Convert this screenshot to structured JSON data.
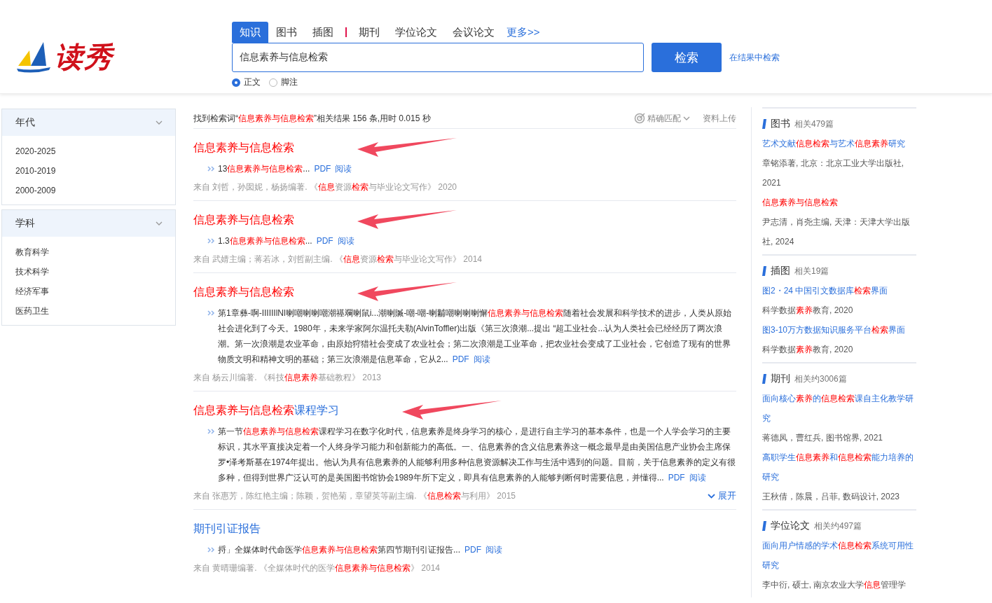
{
  "logo": {
    "text": "读秀"
  },
  "search": {
    "tabs": [
      {
        "label": "知识",
        "selected": true,
        "separated": false
      },
      {
        "label": "图书",
        "selected": false,
        "separated": false
      },
      {
        "label": "插图",
        "selected": false,
        "separated": false
      },
      {
        "label": "期刊",
        "selected": false,
        "separated": true
      },
      {
        "label": "学位论文",
        "selected": false,
        "separated": false
      },
      {
        "label": "会议论文",
        "selected": false,
        "separated": false
      }
    ],
    "more_link": "更多>>",
    "value": "信息素养与信息检索",
    "button": "检索",
    "within_link": "在结果中检索",
    "scopes": [
      {
        "label": "正文",
        "selected": true
      },
      {
        "label": "脚注",
        "selected": false
      }
    ]
  },
  "filters": [
    {
      "title": "年代",
      "items": [
        "2020-2025",
        "2010-2019",
        "2000-2009"
      ]
    },
    {
      "title": "学科",
      "items": [
        "教育科学",
        "技术科学",
        "经济军事",
        "医药卫生"
      ]
    }
  ],
  "summary": "找到检索词“**信息素养与信息检索**”相关结果 156 条,用时 0.015 秒",
  "tools": {
    "match": "精确匹配",
    "upload": "资料上传"
  },
  "results": [
    {
      "title": "**信息素养与信息检索**",
      "snippet": "13**信息素养与信息检索**...",
      "links": [
        "PDF",
        "阅读"
      ],
      "source": "来自 刘哲，孙囡妮，杨扬编著. 《**信息**资源**检索**与毕业论文写作》 2020",
      "marked": true
    },
    {
      "title": "**信息素养与信息检索**",
      "snippet": "1.3**信息素养与信息检索**...",
      "links": [
        "PDF",
        "阅读"
      ],
      "source": "来自 武婧主编；蒋若冰，刘哲副主编. 《**信息**资源**检索**与毕业论文写作》 2014",
      "marked": true
    },
    {
      "title": "**信息素养与信息检索**",
      "snippet": "第1章彝-啊-IIIIIIlNl喇嘲喇喇嘲潮禥斕喇鼠i...潮喇贓-嘲-嘲-喇黼嘲喇喇喇懈**信息素养与信息检索**随着社会发展和科学技术的进步，人类从原始社会进化到了今天。1980年，未来学家阿尔温托夫勒(AlvinToffler)出版《第三次浪潮...提出 “超工业社会...认为人类社会已经经历了两次浪潮。第一次浪潮是农业革命，由原始狩猎社会变成了农业社会；第二次浪潮是工业革命，把农业社会变成了工业社会，它创造了现有的世界物质文明和精神文明的基础；第三次浪潮是信息革命，它从2...",
      "links": [
        "PDF",
        "阅读"
      ],
      "source": "来自 杨云川编著. 《科技**信息素养**基础教程》 2013",
      "marked": true
    },
    {
      "title": "**信息素养与信息检索**课程学习",
      "snippet": "第一节**信息素养与信息检索**课程学习在数字化时代，信息素养是终身学习的核心，是进行自主学习的基本条件，也是一个人学会学习的主要标识，其水平直接决定着一个人终身学习能力和创新能力的高低。一、信息素养的含义信息素养这一概念最早是由美国信息产业协会主席保罗•泽考斯基在1974年提出。他认为具有信息素养的人能够利用多种信息资源解决工作与生活中遇到的问题。目前，关于信息素养的定义有很多种，但得到世界广泛认可的是美国图书馆协会1989年所下定义，即具有信息素养的人能够判断何时需要信息，并懂得...",
      "links": [
        "PDF",
        "阅读"
      ],
      "source": "来自 张惠芳，陈红艳主编；陈颖，贺艳菊，章望英等副主编. 《**信息检索**与利用》 2015",
      "marked": true,
      "expand": "展开"
    },
    {
      "title": "期刊引证报告",
      "snippet": "捋」全媒体时代命医学**信息素养与信息检索**第四节期刊引证报告...",
      "links": [
        "PDF",
        "阅读"
      ],
      "source": "来自 黄晴珊编著. 《全媒体时代的医学**信息素养与信息检索**》 2014",
      "marked": false
    }
  ],
  "related": [
    {
      "category": "图书",
      "count": "相关479篇",
      "items": [
        {
          "title": "艺术文献**信息检索**与艺术**信息素养**研究",
          "meta": "章铭添著, 北京：北京工业大学出版社, 2021"
        },
        {
          "title": "**信息素养与信息检索**",
          "meta": "尹志清，肖尧主编, 天津：天津大学出版社, 2024"
        }
      ]
    },
    {
      "category": "插图",
      "count": "相关19篇",
      "items": [
        {
          "title": "图2・24 中国引文数据库**检索**界面",
          "meta": "科学数据**素养**教育, 2020"
        },
        {
          "title": "图3-10万方数据知识服务平台**检索**界面",
          "meta": "科学数据**素养**教育, 2020"
        }
      ]
    },
    {
      "category": "期刊",
      "count": "相关约3006篇",
      "items": [
        {
          "title": "面向核心**素养**的**信息检索**课自主化教学研究",
          "meta": "蒋德凤，曹红兵, 图书馆界, 2021"
        },
        {
          "title": "高职学生**信息素养**和**信息检索**能力培养的研究",
          "meta": "王秋倩，陈晨，吕菲, 数码设计, 2023"
        }
      ]
    },
    {
      "category": "学位论文",
      "count": "相关约497篇",
      "items": [
        {
          "title": "面向用户情感的学术**信息检索**系统可用性研究",
          "meta": "李中衍, 硕士, 南京农业大学**信息**管理学"
        }
      ]
    }
  ]
}
